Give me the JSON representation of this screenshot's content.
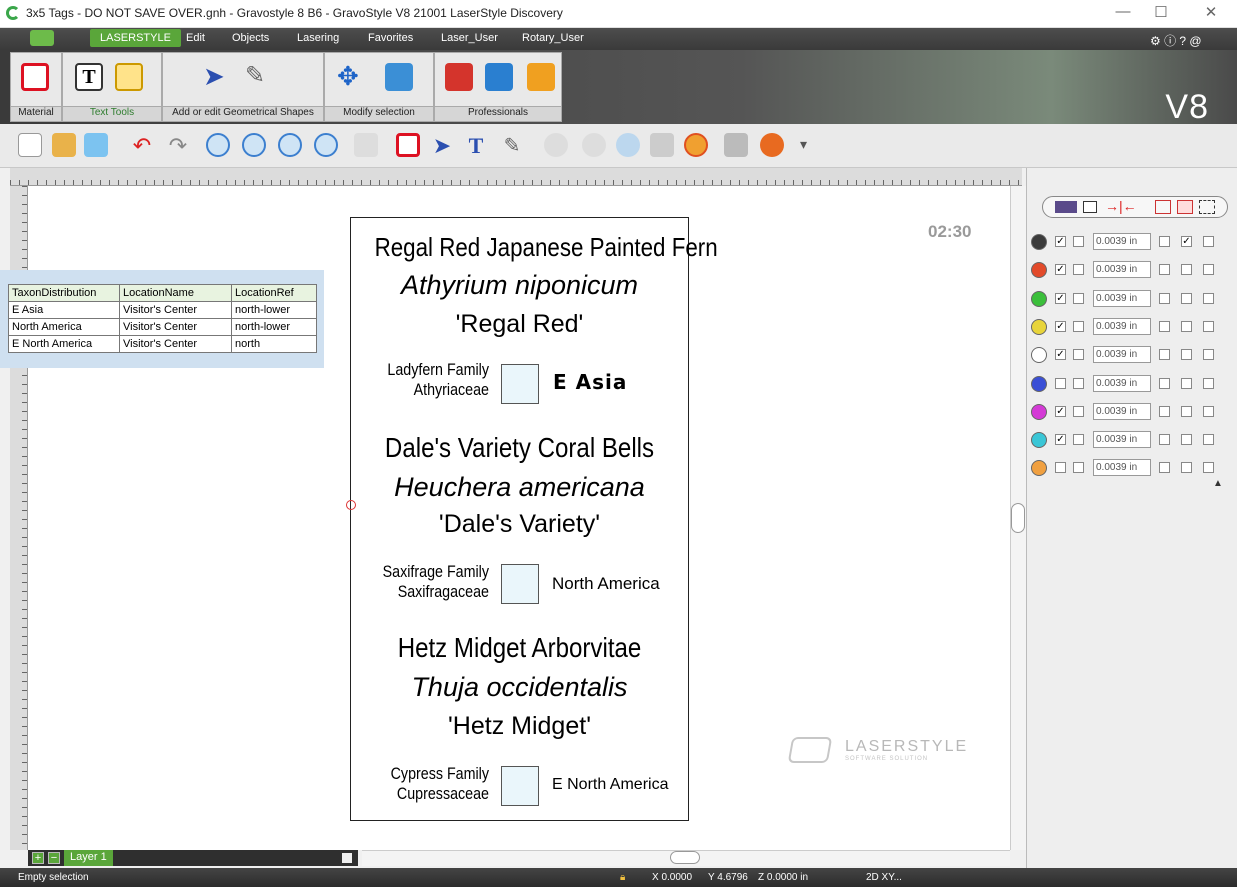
{
  "window": {
    "title": "3x5 Tags - DO NOT SAVE OVER.gnh - Gravostyle 8 B6 - GravoStyle V8 21001 LaserStyle Discovery",
    "controls": [
      "—",
      "☐",
      "✕"
    ]
  },
  "menu": {
    "items": [
      "LASERSTYLE",
      "Edit",
      "Objects",
      "Lasering",
      "Favorites",
      "Laser_User",
      "Rotary_User"
    ],
    "active": "LASERSTYLE"
  },
  "ribbon": {
    "groups": [
      "Material",
      "Text Tools",
      "Add or edit Geometrical Shapes",
      "Modify selection",
      "Professionals"
    ],
    "brand": "V8"
  },
  "canvas": {
    "timer": "02:30",
    "watermark": "LASERSTYLE",
    "watermark_sub": "SOFTWARE SOLUTION"
  },
  "tag": {
    "plants": [
      {
        "common": "Regal Red Japanese Painted Fern",
        "scientific": "Athyrium niponicum",
        "cultivar": "'Regal Red'",
        "family": "Ladyfern Family",
        "family_latin": "Athyriaceae",
        "region": "E Asia"
      },
      {
        "common": "Dale's Variety Coral Bells",
        "scientific": "Heuchera americana",
        "cultivar": "'Dale's Variety'",
        "family": "Saxifrage Family",
        "family_latin": "Saxifragaceae",
        "region": "North America"
      },
      {
        "common": "Hetz Midget Arborvitae",
        "scientific": "Thuja occidentalis",
        "cultivar": "'Hetz Midget'",
        "family": "Cypress Family",
        "family_latin": "Cupressaceae",
        "region": "E North America"
      }
    ]
  },
  "datatable": {
    "headers": [
      "TaxonDistribution",
      "LocationName",
      "LocationRef"
    ],
    "rows": [
      [
        "E Asia",
        "Visitor's Center",
        "north-lower"
      ],
      [
        "North America",
        "Visitor's Center",
        "north-lower"
      ],
      [
        "E North America",
        "Visitor's Center",
        "north"
      ]
    ]
  },
  "pens": {
    "value": "0.0039 in",
    "colors": [
      "#3b3b3b",
      "#e24a2a",
      "#3bbf3b",
      "#e8d43a",
      "#ffffff",
      "#3a4fd6",
      "#d43ad6",
      "#3ac6d6",
      "#f0a040"
    ]
  },
  "layer": {
    "name": "Layer 1"
  },
  "status": {
    "selection": "Empty selection",
    "x": "X 0.0000",
    "y": "Y 4.6796",
    "z": "Z 0.0000 in",
    "mode": "2D XY..."
  }
}
